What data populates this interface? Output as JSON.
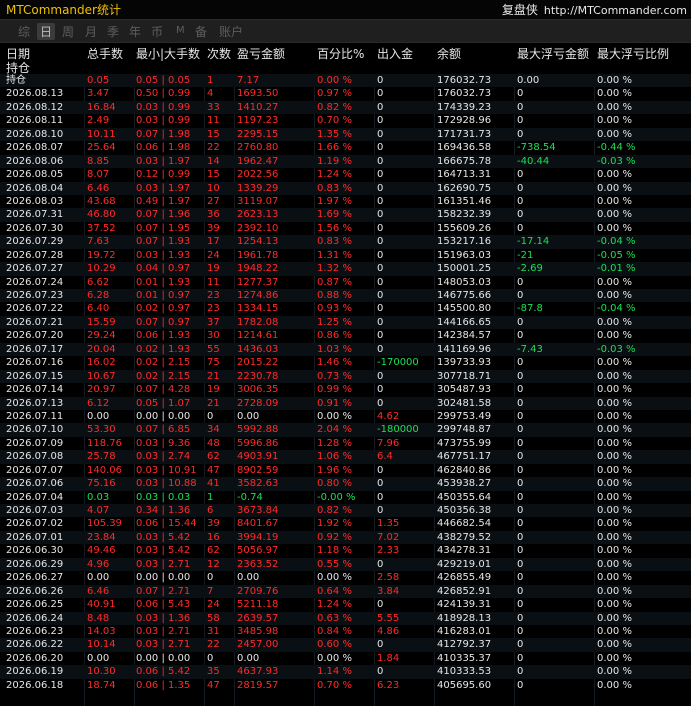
{
  "window": {
    "title": "MTCommander统计"
  },
  "brand": {
    "name": "复盘侠",
    "url": "http://MTCommander.com"
  },
  "tabs": [
    {
      "label": "综",
      "active": false
    },
    {
      "label": "日",
      "active": true
    },
    {
      "label": "周",
      "active": false
    },
    {
      "label": "月",
      "active": false
    },
    {
      "label": "季",
      "active": false
    },
    {
      "label": "年",
      "active": false
    },
    {
      "label": "币",
      "active": false
    },
    {
      "label": "M",
      "active": false
    },
    {
      "label": "备",
      "active": false
    },
    {
      "label": "账户",
      "active": false
    }
  ],
  "columns": {
    "date": "日期",
    "date_sub": "持仓",
    "lots": "总手数",
    "minmax": "最小|大手数",
    "count": "次数",
    "pnl": "盈亏金额",
    "pct": "百分比%",
    "inout": "出入金",
    "balance": "余额",
    "maxloss": "最大浮亏金额",
    "maxratio": "最大浮亏比例"
  },
  "colors": {
    "red": "#ff2a2a",
    "green": "#19e052",
    "white": "#e6e6e6",
    "gold": "#f0c000"
  },
  "rows": [
    {
      "date": "持仓",
      "lots": "0.05",
      "minmax": "0.05 | 0.05",
      "count": "1",
      "pnl": "7.17",
      "pct": "0.00 %",
      "inout": "0",
      "balance": "176032.73",
      "maxloss": "0.00",
      "maxratio": "0.00 %",
      "color": "red",
      "inout_color": "white",
      "mlcolor": "white"
    },
    {
      "date": "2026.08.13",
      "lots": "3.47",
      "minmax": "0.50 | 0.99",
      "count": "4",
      "pnl": "1693.50",
      "pct": "0.97 %",
      "inout": "0",
      "balance": "176032.73",
      "maxloss": "0",
      "maxratio": "0.00 %",
      "color": "red",
      "inout_color": "white",
      "mlcolor": "white"
    },
    {
      "date": "2026.08.12",
      "lots": "16.84",
      "minmax": "0.03 | 0.99",
      "count": "33",
      "pnl": "1410.27",
      "pct": "0.82 %",
      "inout": "0",
      "balance": "174339.23",
      "maxloss": "0",
      "maxratio": "0.00 %",
      "color": "red",
      "inout_color": "white",
      "mlcolor": "white"
    },
    {
      "date": "2026.08.11",
      "lots": "2.49",
      "minmax": "0.03 | 0.99",
      "count": "11",
      "pnl": "1197.23",
      "pct": "0.70 %",
      "inout": "0",
      "balance": "172928.96",
      "maxloss": "0",
      "maxratio": "0.00 %",
      "color": "red",
      "inout_color": "white",
      "mlcolor": "white"
    },
    {
      "date": "2026.08.10",
      "lots": "10.11",
      "minmax": "0.07 | 1.98",
      "count": "15",
      "pnl": "2295.15",
      "pct": "1.35 %",
      "inout": "0",
      "balance": "171731.73",
      "maxloss": "0",
      "maxratio": "0.00 %",
      "color": "red",
      "inout_color": "white",
      "mlcolor": "white"
    },
    {
      "date": "2026.08.07",
      "lots": "25.64",
      "minmax": "0.06 | 1.98",
      "count": "22",
      "pnl": "2760.80",
      "pct": "1.66 %",
      "inout": "0",
      "balance": "169436.58",
      "maxloss": "-738.54",
      "maxratio": "-0.44 %",
      "color": "red",
      "inout_color": "white",
      "mlcolor": "green"
    },
    {
      "date": "2026.08.06",
      "lots": "8.85",
      "minmax": "0.03 | 1.97",
      "count": "14",
      "pnl": "1962.47",
      "pct": "1.19 %",
      "inout": "0",
      "balance": "166675.78",
      "maxloss": "-40.44",
      "maxratio": "-0.03 %",
      "color": "red",
      "inout_color": "white",
      "mlcolor": "green"
    },
    {
      "date": "2026.08.05",
      "lots": "8.07",
      "minmax": "0.12 | 0.99",
      "count": "15",
      "pnl": "2022.56",
      "pct": "1.24 %",
      "inout": "0",
      "balance": "164713.31",
      "maxloss": "0",
      "maxratio": "0.00 %",
      "color": "red",
      "inout_color": "white",
      "mlcolor": "white"
    },
    {
      "date": "2026.08.04",
      "lots": "6.46",
      "minmax": "0.03 | 1.97",
      "count": "10",
      "pnl": "1339.29",
      "pct": "0.83 %",
      "inout": "0",
      "balance": "162690.75",
      "maxloss": "0",
      "maxratio": "0.00 %",
      "color": "red",
      "inout_color": "white",
      "mlcolor": "white"
    },
    {
      "date": "2026.08.03",
      "lots": "43.68",
      "minmax": "0.49 | 1.97",
      "count": "27",
      "pnl": "3119.07",
      "pct": "1.97 %",
      "inout": "0",
      "balance": "161351.46",
      "maxloss": "0",
      "maxratio": "0.00 %",
      "color": "red",
      "inout_color": "white",
      "mlcolor": "white"
    },
    {
      "date": "2026.07.31",
      "lots": "46.80",
      "minmax": "0.07 | 1.96",
      "count": "36",
      "pnl": "2623.13",
      "pct": "1.69 %",
      "inout": "0",
      "balance": "158232.39",
      "maxloss": "0",
      "maxratio": "0.00 %",
      "color": "red",
      "inout_color": "white",
      "mlcolor": "white"
    },
    {
      "date": "2026.07.30",
      "lots": "37.52",
      "minmax": "0.07 | 1.95",
      "count": "39",
      "pnl": "2392.10",
      "pct": "1.56 %",
      "inout": "0",
      "balance": "155609.26",
      "maxloss": "0",
      "maxratio": "0.00 %",
      "color": "red",
      "inout_color": "white",
      "mlcolor": "white"
    },
    {
      "date": "2026.07.29",
      "lots": "7.63",
      "minmax": "0.07 | 1.93",
      "count": "17",
      "pnl": "1254.13",
      "pct": "0.83 %",
      "inout": "0",
      "balance": "153217.16",
      "maxloss": "-17.14",
      "maxratio": "-0.04 %",
      "color": "red",
      "inout_color": "white",
      "mlcolor": "green"
    },
    {
      "date": "2026.07.28",
      "lots": "19.72",
      "minmax": "0.03 | 1.93",
      "count": "24",
      "pnl": "1961.78",
      "pct": "1.31 %",
      "inout": "0",
      "balance": "151963.03",
      "maxloss": "-21",
      "maxratio": "-0.05 %",
      "color": "red",
      "inout_color": "white",
      "mlcolor": "green"
    },
    {
      "date": "2026.07.27",
      "lots": "10.29",
      "minmax": "0.04 | 0.97",
      "count": "19",
      "pnl": "1948.22",
      "pct": "1.32 %",
      "inout": "0",
      "balance": "150001.25",
      "maxloss": "-2.69",
      "maxratio": "-0.01 %",
      "color": "red",
      "inout_color": "white",
      "mlcolor": "green"
    },
    {
      "date": "2026.07.24",
      "lots": "6.62",
      "minmax": "0.01 | 1.93",
      "count": "11",
      "pnl": "1277.37",
      "pct": "0.87 %",
      "inout": "0",
      "balance": "148053.03",
      "maxloss": "0",
      "maxratio": "0.00 %",
      "color": "red",
      "inout_color": "white",
      "mlcolor": "white"
    },
    {
      "date": "2026.07.23",
      "lots": "6.28",
      "minmax": "0.01 | 0.97",
      "count": "23",
      "pnl": "1274.86",
      "pct": "0.88 %",
      "inout": "0",
      "balance": "146775.66",
      "maxloss": "0",
      "maxratio": "0.00 %",
      "color": "red",
      "inout_color": "white",
      "mlcolor": "white"
    },
    {
      "date": "2026.07.22",
      "lots": "6.40",
      "minmax": "0.02 | 0.97",
      "count": "23",
      "pnl": "1334.15",
      "pct": "0.93 %",
      "inout": "0",
      "balance": "145500.80",
      "maxloss": "-87.8",
      "maxratio": "-0.04 %",
      "color": "red",
      "inout_color": "white",
      "mlcolor": "green"
    },
    {
      "date": "2026.07.21",
      "lots": "15.59",
      "minmax": "0.07 | 0.97",
      "count": "37",
      "pnl": "1782.08",
      "pct": "1.25 %",
      "inout": "0",
      "balance": "144166.65",
      "maxloss": "0",
      "maxratio": "0.00 %",
      "color": "red",
      "inout_color": "white",
      "mlcolor": "white"
    },
    {
      "date": "2026.07.20",
      "lots": "29.24",
      "minmax": "0.06 | 1.93",
      "count": "30",
      "pnl": "1214.61",
      "pct": "0.86 %",
      "inout": "0",
      "balance": "142384.57",
      "maxloss": "0",
      "maxratio": "0.00 %",
      "color": "red",
      "inout_color": "white",
      "mlcolor": "white"
    },
    {
      "date": "2026.07.17",
      "lots": "20.04",
      "minmax": "0.02 | 1.93",
      "count": "55",
      "pnl": "1436.03",
      "pct": "1.03 %",
      "inout": "0",
      "balance": "141169.96",
      "maxloss": "-7.43",
      "maxratio": "-0.03 %",
      "color": "red",
      "inout_color": "white",
      "mlcolor": "green"
    },
    {
      "date": "2026.07.16",
      "lots": "16.02",
      "minmax": "0.02 | 2.15",
      "count": "75",
      "pnl": "2015.22",
      "pct": "1.46 %",
      "inout": "-170000",
      "balance": "139733.93",
      "maxloss": "0",
      "maxratio": "0.00 %",
      "color": "red",
      "inout_color": "green",
      "mlcolor": "white"
    },
    {
      "date": "2026.07.15",
      "lots": "10.67",
      "minmax": "0.02 | 2.15",
      "count": "21",
      "pnl": "2230.78",
      "pct": "0.73 %",
      "inout": "0",
      "balance": "307718.71",
      "maxloss": "0",
      "maxratio": "0.00 %",
      "color": "red",
      "inout_color": "white",
      "mlcolor": "white"
    },
    {
      "date": "2026.07.14",
      "lots": "20.97",
      "minmax": "0.07 | 4.28",
      "count": "19",
      "pnl": "3006.35",
      "pct": "0.99 %",
      "inout": "0",
      "balance": "305487.93",
      "maxloss": "0",
      "maxratio": "0.00 %",
      "color": "red",
      "inout_color": "white",
      "mlcolor": "white"
    },
    {
      "date": "2026.07.13",
      "lots": "6.12",
      "minmax": "0.05 | 1.07",
      "count": "21",
      "pnl": "2728.09",
      "pct": "0.91 %",
      "inout": "0",
      "balance": "302481.58",
      "maxloss": "0",
      "maxratio": "0.00 %",
      "color": "red",
      "inout_color": "white",
      "mlcolor": "white"
    },
    {
      "date": "2026.07.11",
      "lots": "0.00",
      "minmax": "0.00 | 0.00",
      "count": "0",
      "pnl": "0.00",
      "pct": "0.00 %",
      "inout": "4.62",
      "balance": "299753.49",
      "maxloss": "0",
      "maxratio": "0.00 %",
      "color": "white",
      "inout_color": "red",
      "mlcolor": "white"
    },
    {
      "date": "2026.07.10",
      "lots": "53.30",
      "minmax": "0.07 | 6.85",
      "count": "34",
      "pnl": "5992.88",
      "pct": "2.04 %",
      "inout": "-180000",
      "balance": "299748.87",
      "maxloss": "0",
      "maxratio": "0.00 %",
      "color": "red",
      "inout_color": "green",
      "mlcolor": "white"
    },
    {
      "date": "2026.07.09",
      "lots": "118.76",
      "minmax": "0.03 | 9.36",
      "count": "48",
      "pnl": "5996.86",
      "pct": "1.28 %",
      "inout": "7.96",
      "balance": "473755.99",
      "maxloss": "0",
      "maxratio": "0.00 %",
      "color": "red",
      "inout_color": "red",
      "mlcolor": "white"
    },
    {
      "date": "2026.07.08",
      "lots": "25.78",
      "minmax": "0.03 | 2.74",
      "count": "62",
      "pnl": "4903.91",
      "pct": "1.06 %",
      "inout": "6.4",
      "balance": "467751.17",
      "maxloss": "0",
      "maxratio": "0.00 %",
      "color": "red",
      "inout_color": "red",
      "mlcolor": "white"
    },
    {
      "date": "2026.07.07",
      "lots": "140.06",
      "minmax": "0.03 | 10.91",
      "count": "47",
      "pnl": "8902.59",
      "pct": "1.96 %",
      "inout": "0",
      "balance": "462840.86",
      "maxloss": "0",
      "maxratio": "0.00 %",
      "color": "red",
      "inout_color": "white",
      "mlcolor": "white"
    },
    {
      "date": "2026.07.06",
      "lots": "75.16",
      "minmax": "0.03 | 10.88",
      "count": "41",
      "pnl": "3582.63",
      "pct": "0.80 %",
      "inout": "0",
      "balance": "453938.27",
      "maxloss": "0",
      "maxratio": "0.00 %",
      "color": "red",
      "inout_color": "white",
      "mlcolor": "white"
    },
    {
      "date": "2026.07.04",
      "lots": "0.03",
      "minmax": "0.03 | 0.03",
      "count": "1",
      "pnl": "-0.74",
      "pct": "-0.00 %",
      "inout": "0",
      "balance": "450355.64",
      "maxloss": "0",
      "maxratio": "0.00 %",
      "color": "green",
      "inout_color": "white",
      "mlcolor": "white"
    },
    {
      "date": "2026.07.03",
      "lots": "4.07",
      "minmax": "0.34 | 1.36",
      "count": "6",
      "pnl": "3673.84",
      "pct": "0.82 %",
      "inout": "0",
      "balance": "450356.38",
      "maxloss": "0",
      "maxratio": "0.00 %",
      "color": "red",
      "inout_color": "white",
      "mlcolor": "white"
    },
    {
      "date": "2026.07.02",
      "lots": "105.39",
      "minmax": "0.06 | 15.44",
      "count": "39",
      "pnl": "8401.67",
      "pct": "1.92 %",
      "inout": "1.35",
      "balance": "446682.54",
      "maxloss": "0",
      "maxratio": "0.00 %",
      "color": "red",
      "inout_color": "red",
      "mlcolor": "white"
    },
    {
      "date": "2026.07.01",
      "lots": "23.84",
      "minmax": "0.03 | 5.42",
      "count": "16",
      "pnl": "3994.19",
      "pct": "0.92 %",
      "inout": "7.02",
      "balance": "438279.52",
      "maxloss": "0",
      "maxratio": "0.00 %",
      "color": "red",
      "inout_color": "red",
      "mlcolor": "white"
    },
    {
      "date": "2026.06.30",
      "lots": "49.46",
      "minmax": "0.03 | 5.42",
      "count": "62",
      "pnl": "5056.97",
      "pct": "1.18 %",
      "inout": "2.33",
      "balance": "434278.31",
      "maxloss": "0",
      "maxratio": "0.00 %",
      "color": "red",
      "inout_color": "red",
      "mlcolor": "white"
    },
    {
      "date": "2026.06.29",
      "lots": "4.96",
      "minmax": "0.03 | 2.71",
      "count": "12",
      "pnl": "2363.52",
      "pct": "0.55 %",
      "inout": "0",
      "balance": "429219.01",
      "maxloss": "0",
      "maxratio": "0.00 %",
      "color": "red",
      "inout_color": "white",
      "mlcolor": "white"
    },
    {
      "date": "2026.06.27",
      "lots": "0.00",
      "minmax": "0.00 | 0.00",
      "count": "0",
      "pnl": "0.00",
      "pct": "0.00 %",
      "inout": "2.58",
      "balance": "426855.49",
      "maxloss": "0",
      "maxratio": "0.00 %",
      "color": "white",
      "inout_color": "red",
      "mlcolor": "white"
    },
    {
      "date": "2026.06.26",
      "lots": "6.46",
      "minmax": "0.07 | 2.71",
      "count": "7",
      "pnl": "2709.76",
      "pct": "0.64 %",
      "inout": "3.84",
      "balance": "426852.91",
      "maxloss": "0",
      "maxratio": "0.00 %",
      "color": "red",
      "inout_color": "red",
      "mlcolor": "white"
    },
    {
      "date": "2026.06.25",
      "lots": "40.91",
      "minmax": "0.06 | 5.43",
      "count": "24",
      "pnl": "5211.18",
      "pct": "1.24 %",
      "inout": "0",
      "balance": "424139.31",
      "maxloss": "0",
      "maxratio": "0.00 %",
      "color": "red",
      "inout_color": "white",
      "mlcolor": "white"
    },
    {
      "date": "2026.06.24",
      "lots": "8.48",
      "minmax": "0.03 | 1.36",
      "count": "58",
      "pnl": "2639.57",
      "pct": "0.63 %",
      "inout": "5.55",
      "balance": "418928.13",
      "maxloss": "0",
      "maxratio": "0.00 %",
      "color": "red",
      "inout_color": "red",
      "mlcolor": "white"
    },
    {
      "date": "2026.06.23",
      "lots": "14.03",
      "minmax": "0.03 | 2.71",
      "count": "31",
      "pnl": "3485.98",
      "pct": "0.84 %",
      "inout": "4.86",
      "balance": "416283.01",
      "maxloss": "0",
      "maxratio": "0.00 %",
      "color": "red",
      "inout_color": "red",
      "mlcolor": "white"
    },
    {
      "date": "2026.06.22",
      "lots": "10.14",
      "minmax": "0.03 | 2.71",
      "count": "22",
      "pnl": "2457.00",
      "pct": "0.60 %",
      "inout": "0",
      "balance": "412792.37",
      "maxloss": "0",
      "maxratio": "0.00 %",
      "color": "red",
      "inout_color": "white",
      "mlcolor": "white"
    },
    {
      "date": "2026.06.20",
      "lots": "0.00",
      "minmax": "0.00 | 0.00",
      "count": "0",
      "pnl": "0.00",
      "pct": "0.00 %",
      "inout": "1.84",
      "balance": "410335.37",
      "maxloss": "0",
      "maxratio": "0.00 %",
      "color": "white",
      "inout_color": "red",
      "mlcolor": "white"
    },
    {
      "date": "2026.06.19",
      "lots": "10.30",
      "minmax": "0.06 | 5.42",
      "count": "35",
      "pnl": "4637.93",
      "pct": "1.14 %",
      "inout": "0",
      "balance": "410333.53",
      "maxloss": "0",
      "maxratio": "0.00 %",
      "color": "red",
      "inout_color": "white",
      "mlcolor": "white"
    },
    {
      "date": "2026.06.18",
      "lots": "18.74",
      "minmax": "0.06 | 1.35",
      "count": "47",
      "pnl": "2819.57",
      "pct": "0.70 %",
      "inout": "6.23",
      "balance": "405695.60",
      "maxloss": "0",
      "maxratio": "0.00 %",
      "color": "red",
      "inout_color": "red",
      "mlcolor": "white"
    }
  ]
}
